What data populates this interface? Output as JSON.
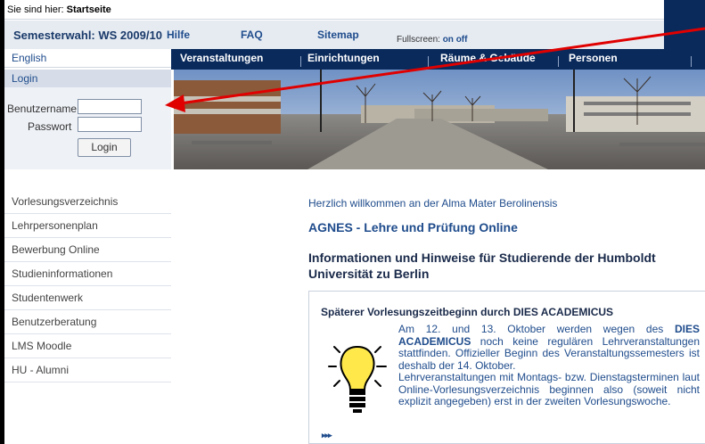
{
  "breadcrumb": {
    "prefix": "Sie sind hier:",
    "current": "Startseite"
  },
  "toprow": {
    "semester": "Semesterwahl: WS 2009/10",
    "links": [
      "Hilfe",
      "FAQ",
      "Sitemap"
    ],
    "fullscreen_label": "Fullscreen:",
    "fullscreen_on": "on",
    "fullscreen_off": "off"
  },
  "language_link": "English",
  "mainnav": [
    "Veranstaltungen",
    "Einrichtungen",
    "Räume & Gebäude",
    "Personen"
  ],
  "login": {
    "heading": "Login",
    "username_label": "Benutzername",
    "password_label": "Passwort",
    "button": "Login"
  },
  "leftnav": [
    "Vorlesungsverzeichnis",
    "Lehrpersonenplan",
    "Bewerbung Online",
    "Studieninformationen",
    "Studentenwerk",
    "Benutzerberatung",
    "LMS Moodle",
    "HU - Alumni"
  ],
  "main": {
    "welcome": "Herzlich willkommen an der Alma Mater Berolinensis",
    "agnes": "AGNES - Lehre und Prüfung Online",
    "info": "Informationen und Hinweise für Studierende der Humboldt Universität zu Berlin"
  },
  "news": {
    "title": "Späterer Vorlesungszeitbeginn durch DIES ACADEMICUS",
    "p1_a": "Am 12. und 13. Oktober werden wegen des ",
    "p1_b": "DIES ACADEMICUS",
    "p1_c": " noch keine regulären Lehrveranstaltungen stattfinden. Offizieller Beginn des Veranstaltungssemesters ist deshalb der 14. Oktober.",
    "p2": "Lehrveranstaltungen mit Montags- bzw. Dienstagsterminen laut Online-Vorlesungsverzeichnis beginnen also (soweit nicht explizit angegeben) erst in der zweiten Vorlesungswoche.",
    "more": "▸▸▸"
  },
  "colors": {
    "navy": "#0a2a5c",
    "link": "#1f4c8c",
    "annotation_arrow": "#e00000"
  }
}
